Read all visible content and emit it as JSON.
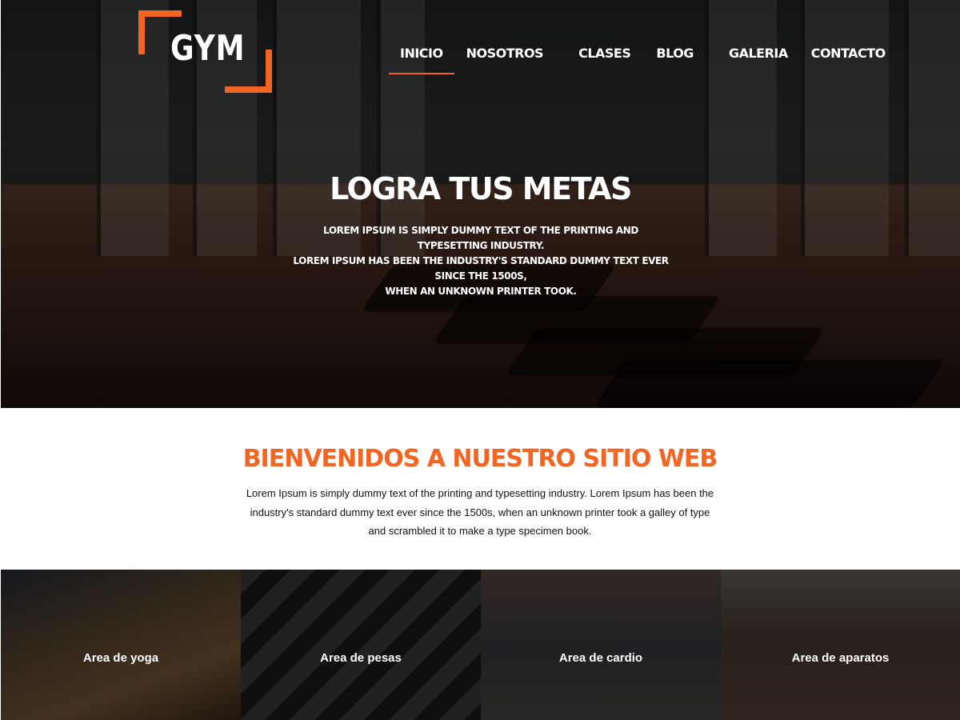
{
  "brand": {
    "logo_text": "GYM",
    "accent": "#f26522"
  },
  "nav": {
    "items": [
      {
        "label": "INICIO",
        "active": true
      },
      {
        "label": "NOSOTROS",
        "active": false
      },
      {
        "label": "CLASES",
        "active": false
      },
      {
        "label": "BLOG",
        "active": false
      },
      {
        "label": "GALERIA",
        "active": false
      },
      {
        "label": "CONTACTO",
        "active": false
      }
    ]
  },
  "hero": {
    "title": "LOGRA TUS METAS",
    "text_line1": "Lorem Ipsum is simply dummy text of the printing and typesetting industry.",
    "text_line2": "Lorem Ipsum has been the industry's standard dummy text ever since the 1500s,",
    "text_line3": "when an unknown printer took."
  },
  "welcome": {
    "title": "BIENVENIDOS A NUESTRO SITIO WEB",
    "text": "Lorem Ipsum is simply dummy text of the printing and typesetting industry. Lorem Ipsum has been the industry's standard dummy text ever since the 1500s, when an unknown printer took a galley of type and scrambled it to make a type specimen book."
  },
  "areas": [
    {
      "label": "Area de yoga"
    },
    {
      "label": "Area de pesas"
    },
    {
      "label": "Area de cardio"
    },
    {
      "label": "Area de aparatos"
    }
  ]
}
